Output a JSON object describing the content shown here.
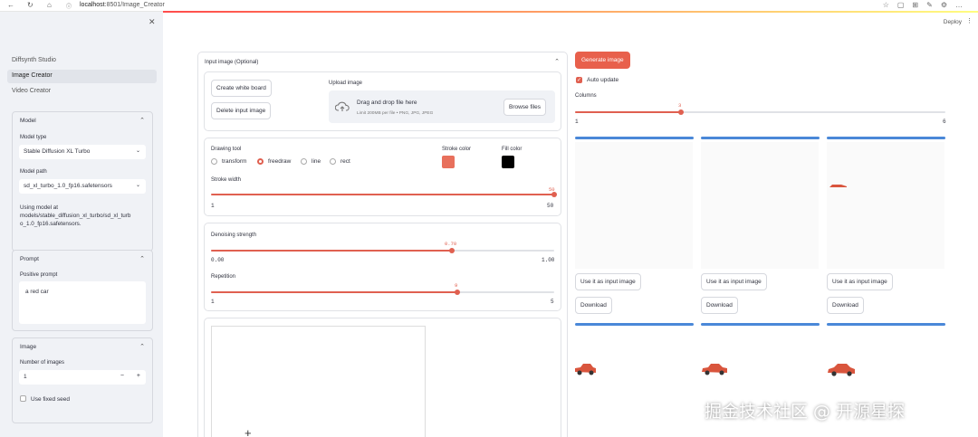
{
  "browser": {
    "url_host": "localhost",
    "url_rest": ":8501/Image_Creator",
    "deploy": "Deploy"
  },
  "sidebar": {
    "nav": [
      "Diffsynth Studio",
      "Image Creator",
      "Video Creator"
    ],
    "model": {
      "header": "Model",
      "type_label": "Model type",
      "type_value": "Stable Diffusion XL Turbo",
      "path_label": "Model path",
      "path_value": "sd_xl_turbo_1.0_fp16.safetensors",
      "using": [
        "Using model at",
        "models/stable_diffusion_xl_turbo/sd_xl_turb",
        "o_1.0_fp16.safetensors."
      ]
    },
    "prompt": {
      "header": "Prompt",
      "positive_label": "Positive prompt",
      "positive_value": "a red car"
    },
    "image": {
      "header": "Image",
      "num_label": "Number of images",
      "num_value": "1",
      "minus": "−",
      "plus": "+",
      "fixed_seed": "Use fixed seed"
    }
  },
  "input_image": {
    "header": "Input image (Optional)",
    "create_btn": "Create white board",
    "delete_btn": "Delete input image",
    "upload_label": "Upload image",
    "drag_text": "Drag and drop file here",
    "limit_text": "Limit 200MB per file • PNG, JPG, JPEG",
    "browse_btn": "Browse files"
  },
  "drawing": {
    "tool_label": "Drawing tool",
    "tools": [
      "transform",
      "freedraw",
      "line",
      "rect"
    ],
    "selected_tool": "freedraw",
    "stroke_color_label": "Stroke color",
    "stroke_color": "#e8705c",
    "fill_color_label": "Fill color",
    "fill_color": "#000000",
    "stroke_width_label": "Stroke width",
    "stroke_width": {
      "value": "50",
      "min": "1",
      "max": "50",
      "fraction": 1.0
    }
  },
  "denoise": {
    "label": "Denoising strength",
    "value": "0.70",
    "min": "0.00",
    "max": "1.00",
    "fraction": 0.7,
    "rep_label": "Repetition",
    "rep_value": "9",
    "rep_min": "1",
    "rep_max": "5",
    "rep_fraction": 0.7
  },
  "canvas": {
    "cursor": "+"
  },
  "right": {
    "generate_btn": "Generate image",
    "auto_update": "Auto update",
    "columns_label": "Columns",
    "columns_value": "3",
    "columns_min": "1",
    "columns_max": "6",
    "columns_fraction": 0.4,
    "use_btn": "Use it as input image",
    "download_btn": "Download"
  },
  "watermark": "掘金技术社区 @ 开源星探",
  "colors": {
    "accent": "#e06050",
    "blue": "#4a88d8"
  }
}
